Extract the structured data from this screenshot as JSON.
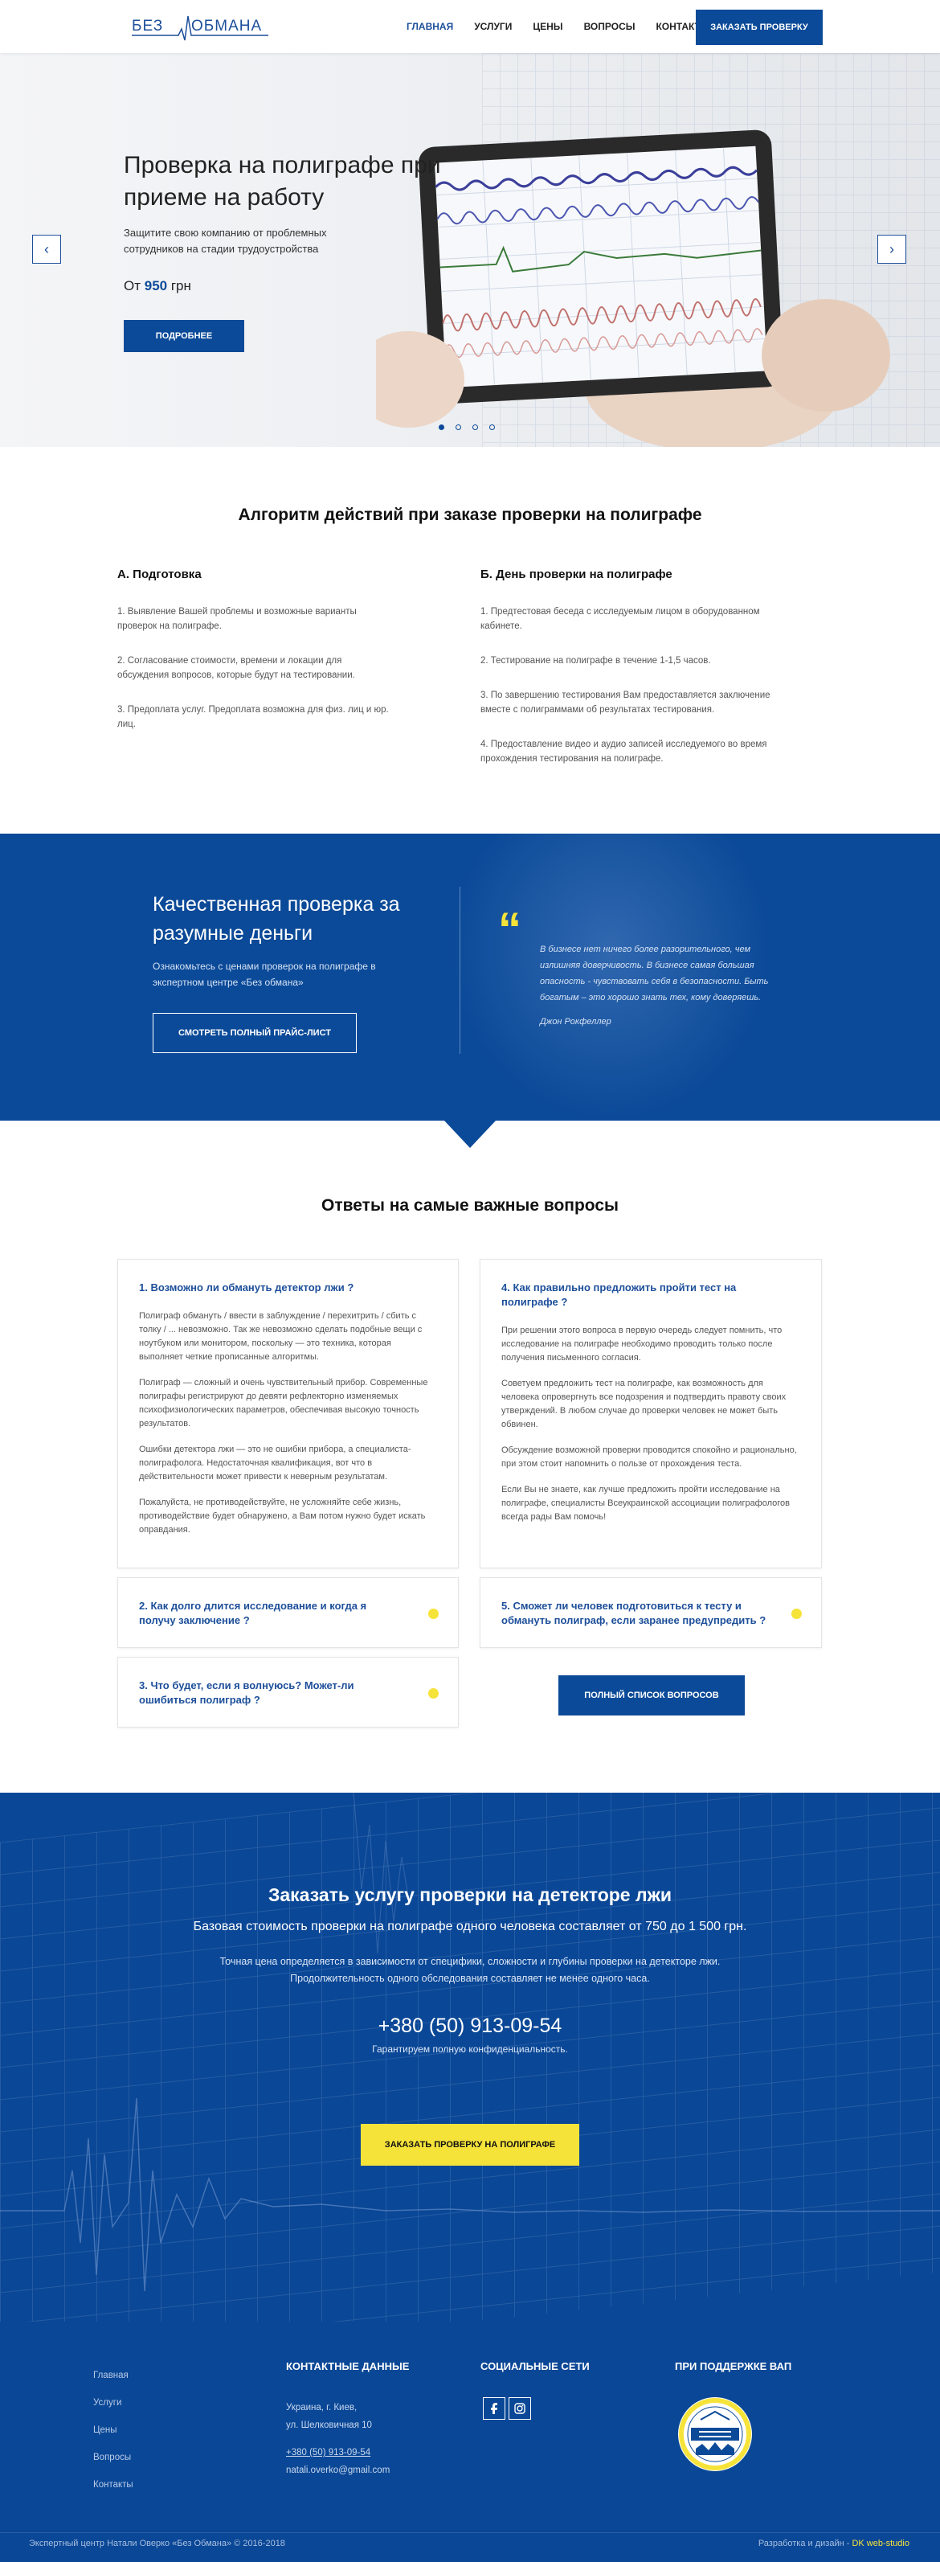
{
  "header": {
    "logo_left": "БЕЗ",
    "logo_right": "ОБМАНА",
    "nav": [
      "ГЛАВНАЯ",
      "УСЛУГИ",
      "ЦЕНЫ",
      "ВОПРОСЫ",
      "КОНТАКТЫ"
    ],
    "cta": "ЗАКАЗАТЬ ПРОВЕРКУ"
  },
  "hero": {
    "title": "Проверка на полиграфе при приеме на работу",
    "subtitle": "Защитите свою компанию от проблемных сотрудников на стадии трудоустройства",
    "price_prefix": "От",
    "price_value": "950",
    "price_suffix": "грн",
    "button": "ПОДРОБНЕЕ",
    "prev_icon": "‹",
    "next_icon": "›",
    "slides_total": 4,
    "slide_active": 1
  },
  "algorithm": {
    "title": "Алгоритм действий при заказе проверки на полиграфе",
    "col_a": {
      "heading": "А. Подготовка",
      "items": [
        "1. Выявление Вашей проблемы и возможные варианты проверок на полиграфе.",
        "2. Согласование стоимости, времени и локации для обсуждения вопросов, которые будут на тестировании.",
        "3. Предоплата услуг. Предоплата возможна для физ. лиц и юр. лиц."
      ]
    },
    "col_b": {
      "heading": "Б. День проверки на полиграфе",
      "items": [
        "1. Предтестовая беседа с исследуемым лицом в оборудованном кабинете.",
        "2. Тестирование на полиграфе в течение 1-1,5 часов.",
        "3. По завершению тестирования Вам предоставляется заключение вместе с полиграммами об результатах тестирования.",
        "4. Предоставление видео и аудио записей исследуемого во время прохождения тестирования на полиграфе."
      ]
    }
  },
  "quality": {
    "title": "Качественная проверка за разумные деньги",
    "desc": "Ознакомьтесь с ценами проверок на полиграфе в экспертном центре «Без обмана»",
    "button": "СМОТРЕТЬ ПОЛНЫЙ ПРАЙС-ЛИСТ",
    "quote_mark": "“",
    "quote": "В бизнесе нет ничего более разорительного, чем излишняя доверчивость. В бизнесе самая большая опасность - чувствовать себя в безопасности. Быть богатым – это хорошо знать тех, кому доверяешь.",
    "author": "Джон Рокфеллер"
  },
  "faq": {
    "title": "Ответы на самые важные вопросы",
    "q1": {
      "title": "1. Возможно ли обмануть детектор лжи ?",
      "paragraphs": [
        "Полиграф обмануть / ввести в заблуждение / перехитрить / сбить с толку / ... невозможно. Так же невозможно сделать подобные вещи с ноутбуком или монитором, поскольку — это техника, которая выполняет четкие прописанные алгоритмы.",
        "Полиграф — сложный и очень чувствительный прибор. Современные полиграфы регистрируют до девяти рефлекторно изменяемых психофизиологических параметров, обеспечивая высокую точность результатов.",
        "Ошибки детектора лжи — это не ошибки прибора, а специалиста-полиграфолога. Недостаточная квалификация, вот что в действительности может привести к неверным результатам.",
        "Пожалуйста, не противодействуйте, не усложняйте себе жизнь, противодействие будет обнаружено, а Вам потом нужно будет искать оправдания."
      ]
    },
    "q4": {
      "title": "4. Как правильно предложить пройти тест на полиграфе ?",
      "paragraphs": [
        "При решении этого вопроса в первую очередь следует помнить, что исследование на полиграфе необходимо проводить только после получения письменного согласия.",
        "Советуем предложить тест на полиграфе, как возможность для человека опровергнуть все подозрения и подтвердить правоту своих утверждений. В любом случае до проверки человек не может быть обвинен.",
        "Обсуждение возможной проверки проводится спокойно и рационально, при этом стоит напомнить о пользе от прохождения теста.",
        "Если Вы не знаете, как лучше предложить пройти исследование на полиграфе, специалисты Всеукраинской ассоциации полиграфологов всегда рады Вам помочь!"
      ]
    },
    "q2": {
      "title": "2. Как долго длится исследование и когда я получу заключение ?"
    },
    "q5": {
      "title": "5. Сможет ли человек подготовиться к тесту и обмануть полиграф, если заранее предупредить ?"
    },
    "q3": {
      "title": "3. Что будет, если я волнуюсь? Может-ли ошибиться полиграф ?"
    },
    "button": "ПОЛНЫЙ СПИСОК ВОПРОСОВ"
  },
  "order": {
    "title": "Заказать услугу проверки на детекторе лжи",
    "line2": "Базовая стоимость проверки на полиграфе одного человека составляет от 750 до 1 500 грн.",
    "line3a": "Точная цена определяется в зависимости от специфики, сложности и глубины проверки на детекторе лжи.",
    "line3b": "Продолжительность одного обследования составляет не менее одного часа.",
    "phone": "+380 (50) 913-09-54",
    "guarantee": "Гарантируем полную конфиденциальность.",
    "button": "ЗАКАЗАТЬ ПРОВЕРКУ НА ПОЛИГРАФЕ"
  },
  "footer": {
    "nav": [
      "Главная",
      "Услуги",
      "Цены",
      "Вопросы",
      "Контакты"
    ],
    "contacts_title": "КОНТАКТНЫЕ ДАННЫЕ",
    "address1": "Украина, г. Киев,",
    "address2": "ул. Шелковичная 10",
    "phone": "+380 (50) 913-09-54",
    "email": "natali.overko@gmail.com",
    "social_title": "СОЦИАЛЬНЫЕ СЕТИ",
    "social_icons": [
      "facebook-icon",
      "instagram-icon"
    ],
    "support_title": "ПРИ ПОДДЕРЖКЕ ВАП",
    "copyright": "Экспертный центр Натали Оверко «Без Обмана» © 2016-2018",
    "dev_prefix": "Разработка и дизайн -",
    "dev_name": "DK web-studio"
  },
  "colors": {
    "brand_blue": "#0b4a98",
    "accent_yellow": "#f6e33a",
    "text_dark": "#222222"
  }
}
